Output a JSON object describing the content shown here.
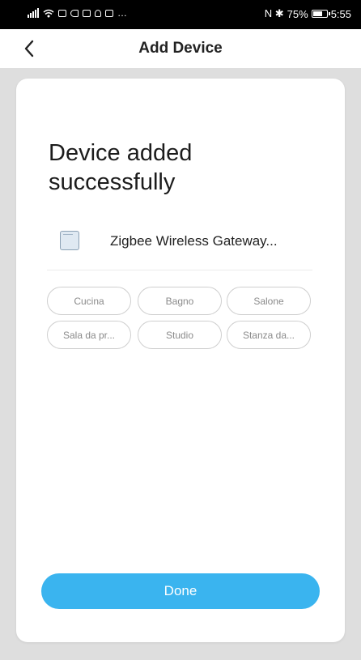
{
  "status_bar": {
    "indicators": "…",
    "nfc_bt": "N ✱",
    "battery_percent": "75%",
    "battery_level": 0.75,
    "time": "5:55"
  },
  "nav": {
    "back_icon": "chevron-left-icon",
    "title": "Add Device"
  },
  "main": {
    "headline": "Device added successfully",
    "device": {
      "icon": "gateway-device-icon",
      "name": "Zigbee Wireless Gateway..."
    },
    "rooms": [
      {
        "label": "Cucina"
      },
      {
        "label": "Bagno"
      },
      {
        "label": "Salone"
      },
      {
        "label": "Sala da pr..."
      },
      {
        "label": "Studio"
      },
      {
        "label": "Stanza da..."
      }
    ],
    "done_label": "Done"
  },
  "colors": {
    "accent": "#3ab4ef",
    "background": "#dedede"
  }
}
